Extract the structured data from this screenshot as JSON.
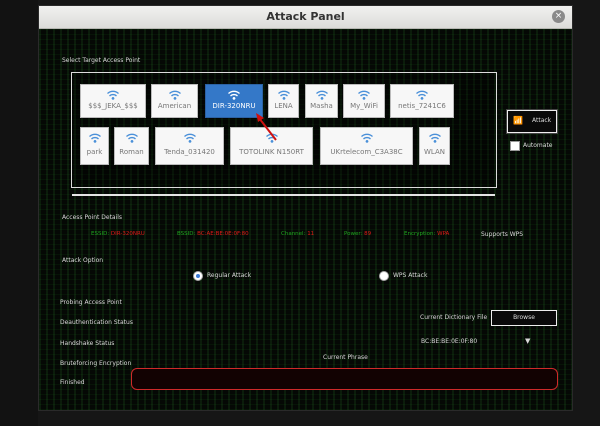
{
  "window": {
    "title": "Attack Panel",
    "close_glyph": "×"
  },
  "section_select_label": "Select Target Access Point",
  "access_points": {
    "row1": [
      {
        "name": "$$$_JEKA_$$$",
        "selected": false
      },
      {
        "name": "American",
        "selected": false
      },
      {
        "name": "DIR-320NRU",
        "selected": true
      },
      {
        "name": "LENA",
        "selected": false
      },
      {
        "name": "Masha",
        "selected": false
      },
      {
        "name": "My_WiFi",
        "selected": false
      },
      {
        "name": "netis_7241C6",
        "selected": false
      }
    ],
    "row2": [
      {
        "name": "park",
        "selected": false
      },
      {
        "name": "Roman",
        "selected": false
      },
      {
        "name": "Tenda_031420",
        "selected": false
      },
      {
        "name": "TOTOLINK N150RT",
        "selected": false
      },
      {
        "name": "UKrtelecom_C3A38C",
        "selected": false
      },
      {
        "name": "WLAN",
        "selected": false
      }
    ]
  },
  "attack_button": {
    "icon": "wifi-icon",
    "label": "Attack"
  },
  "automate_label": "Automate",
  "details": {
    "section_label": "Access Point Details",
    "essid_key": "ESSID:",
    "essid_val": "DIR-320NRU",
    "bssid_key": "BSSID:",
    "bssid_val": "BC:AE:BE:0E:0F:80",
    "channel_key": "Channel:",
    "channel_val": "11",
    "power_key": "Power:",
    "power_val": "89",
    "encryption_key": "Encryption:",
    "encryption_val": "WPA",
    "wps_text": "Supports WPS"
  },
  "attack_option": {
    "label": "Attack Option",
    "regular": "Regular Attack",
    "wps": "WPS Attack"
  },
  "status": {
    "probing": "Probing Access Point",
    "deauth": "Deauthentication Status",
    "handshake": "Handshake Status",
    "bruteforce": "Bruteforcing Encryption",
    "finished": "Finished"
  },
  "dictionary": {
    "label": "Current Dictionary File",
    "browse": "Browse",
    "mac": "BC:BE:BE:0E:0F:80",
    "dropdown_glyph": "▼"
  },
  "current_phrase_label": "Current Phrase",
  "colors": {
    "accent": "#3478c8",
    "key_green": "#1fa51f",
    "value_red": "#e01818",
    "phrase_border": "#cf2a2a"
  }
}
